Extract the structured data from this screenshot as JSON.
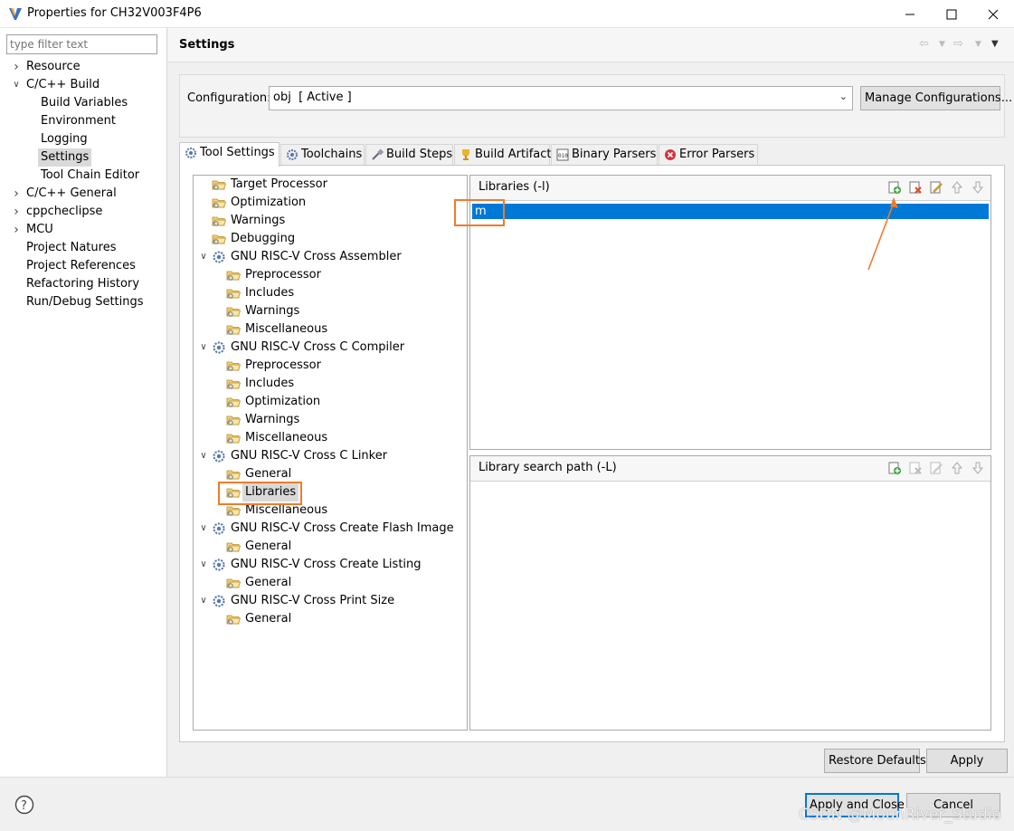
{
  "window": {
    "title": "Properties for CH32V003F4P6"
  },
  "filter": {
    "placeholder": "type filter text"
  },
  "nav": {
    "items": [
      {
        "label": "Resource",
        "level": 0,
        "expander": "collapsed"
      },
      {
        "label": "C/C++ Build",
        "level": 0,
        "expander": "expanded"
      },
      {
        "label": "Build Variables",
        "level": 1,
        "expander": "none"
      },
      {
        "label": "Environment",
        "level": 1,
        "expander": "none"
      },
      {
        "label": "Logging",
        "level": 1,
        "expander": "none"
      },
      {
        "label": "Settings",
        "level": 1,
        "expander": "none",
        "selected": true
      },
      {
        "label": "Tool Chain Editor",
        "level": 1,
        "expander": "none"
      },
      {
        "label": "C/C++ General",
        "level": 0,
        "expander": "collapsed"
      },
      {
        "label": "cppcheclipse",
        "level": 0,
        "expander": "collapsed"
      },
      {
        "label": "MCU",
        "level": 0,
        "expander": "collapsed"
      },
      {
        "label": "Project Natures",
        "level": 0,
        "expander": "none"
      },
      {
        "label": "Project References",
        "level": 0,
        "expander": "none"
      },
      {
        "label": "Refactoring History",
        "level": 0,
        "expander": "none"
      },
      {
        "label": "Run/Debug Settings",
        "level": 0,
        "expander": "none"
      }
    ]
  },
  "main": {
    "title": "Settings",
    "config_label": "Configuration:",
    "config_value": "obj  [ Active ]",
    "manage_button": "Manage Configurations...",
    "tabs": [
      {
        "label": "Tool Settings",
        "icon": "gear-icon",
        "active": true
      },
      {
        "label": "Toolchains",
        "icon": "gear-icon"
      },
      {
        "label": "Build Steps",
        "icon": "build-steps-icon"
      },
      {
        "label": "Build Artifact",
        "icon": "trophy-icon"
      },
      {
        "label": "Binary Parsers",
        "icon": "binary-icon"
      },
      {
        "label": "Error Parsers",
        "icon": "error-icon"
      }
    ],
    "tool_tree": [
      {
        "label": "Target Processor",
        "level": 1,
        "kind": "folder"
      },
      {
        "label": "Optimization",
        "level": 1,
        "kind": "folder"
      },
      {
        "label": "Warnings",
        "level": 1,
        "kind": "folder"
      },
      {
        "label": "Debugging",
        "level": 1,
        "kind": "folder"
      },
      {
        "label": "GNU RISC-V Cross Assembler",
        "level": 0,
        "kind": "tool"
      },
      {
        "label": "Preprocessor",
        "level": 2,
        "kind": "folder"
      },
      {
        "label": "Includes",
        "level": 2,
        "kind": "folder"
      },
      {
        "label": "Warnings",
        "level": 2,
        "kind": "folder"
      },
      {
        "label": "Miscellaneous",
        "level": 2,
        "kind": "folder"
      },
      {
        "label": "GNU RISC-V Cross C Compiler",
        "level": 0,
        "kind": "tool"
      },
      {
        "label": "Preprocessor",
        "level": 2,
        "kind": "folder"
      },
      {
        "label": "Includes",
        "level": 2,
        "kind": "folder"
      },
      {
        "label": "Optimization",
        "level": 2,
        "kind": "folder"
      },
      {
        "label": "Warnings",
        "level": 2,
        "kind": "folder"
      },
      {
        "label": "Miscellaneous",
        "level": 2,
        "kind": "folder"
      },
      {
        "label": "GNU RISC-V Cross C Linker",
        "level": 0,
        "kind": "tool"
      },
      {
        "label": "General",
        "level": 2,
        "kind": "folder"
      },
      {
        "label": "Libraries",
        "level": 2,
        "kind": "folder",
        "selected": true
      },
      {
        "label": "Miscellaneous",
        "level": 2,
        "kind": "folder"
      },
      {
        "label": "GNU RISC-V Cross Create Flash Image",
        "level": 0,
        "kind": "tool"
      },
      {
        "label": "General",
        "level": 2,
        "kind": "folder"
      },
      {
        "label": "GNU RISC-V Cross Create Listing",
        "level": 0,
        "kind": "tool"
      },
      {
        "label": "General",
        "level": 2,
        "kind": "folder"
      },
      {
        "label": "GNU RISC-V Cross Print Size",
        "level": 0,
        "kind": "tool"
      },
      {
        "label": "General",
        "level": 2,
        "kind": "folder"
      }
    ],
    "libraries_panel": {
      "title": "Libraries (-l)",
      "items": [
        "m"
      ],
      "tools": [
        "add-icon",
        "delete-icon",
        "edit-icon",
        "move-up-icon",
        "move-down-icon"
      ]
    },
    "search_path_panel": {
      "title": "Library search path (-L)",
      "items": [],
      "tools": [
        "add-icon",
        "delete-icon",
        "edit-icon",
        "move-up-icon",
        "move-down-icon"
      ]
    },
    "restore_defaults": "Restore Defaults",
    "apply": "Apply"
  },
  "footer": {
    "apply_close": "Apply and Close",
    "cancel": "Cancel",
    "watermark": "CSDN @MounRiver_Studio"
  },
  "colors": {
    "selection": "#0078d7",
    "annotation": "#f07b2b"
  }
}
